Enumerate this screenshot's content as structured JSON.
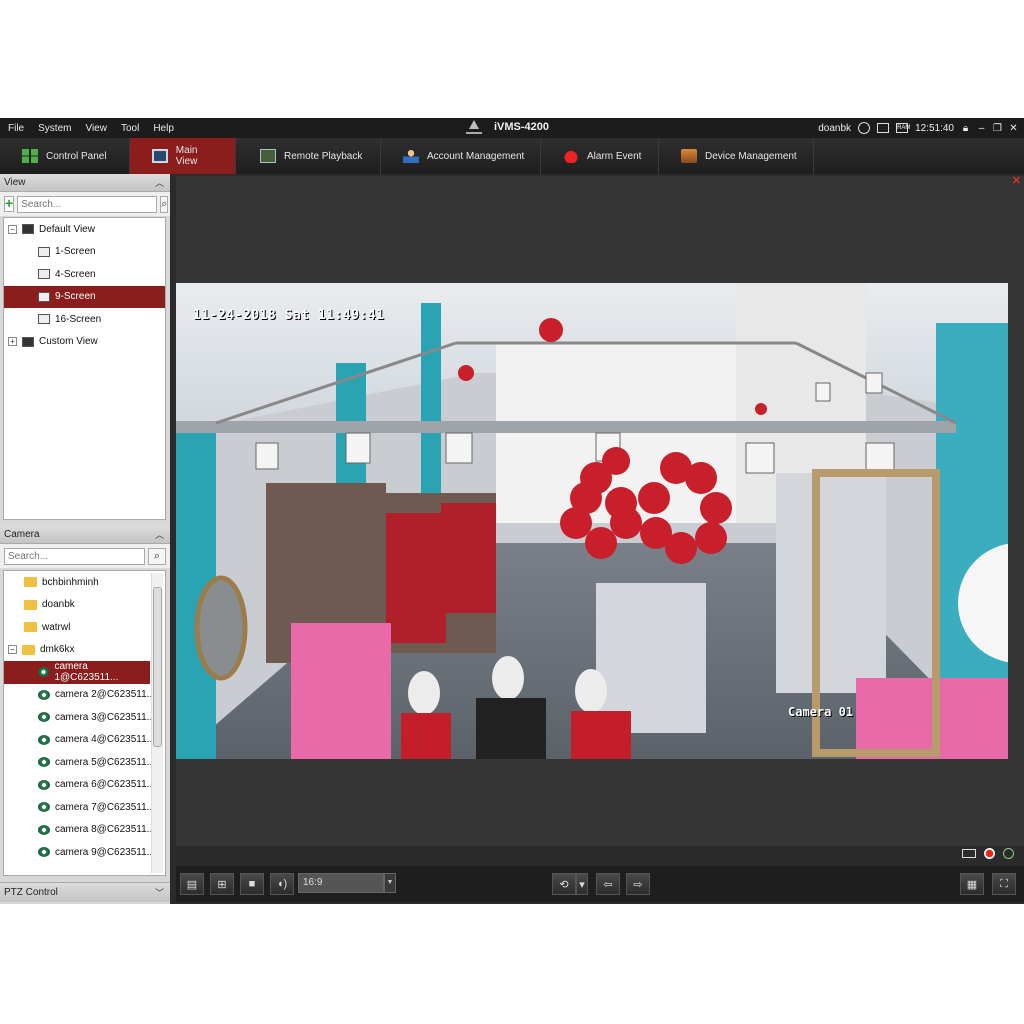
{
  "menu": [
    "File",
    "System",
    "View",
    "Tool",
    "Help"
  ],
  "app_title": "iVMS-4200",
  "status": {
    "user": "doanbk",
    "ram_label": "RAM",
    "time": "12:51:40"
  },
  "tabs": [
    {
      "label": "Control Panel",
      "icon": "control-panel-icon"
    },
    {
      "label": "Main View",
      "icon": "main-view-icon"
    },
    {
      "label": "Remote Playback",
      "icon": "remote-playback-icon"
    },
    {
      "label": "Account Management",
      "icon": "account-management-icon"
    },
    {
      "label": "Alarm Event",
      "icon": "alarm-event-icon"
    },
    {
      "label": "Device Management",
      "icon": "device-management-icon"
    }
  ],
  "view_panel": {
    "title": "View",
    "search_placeholder": "Search...",
    "tree": [
      {
        "label": "Default View",
        "level": 0,
        "expander": "−"
      },
      {
        "label": "1-Screen",
        "level": 1
      },
      {
        "label": "4-Screen",
        "level": 1
      },
      {
        "label": "9-Screen",
        "level": 1,
        "selected": true
      },
      {
        "label": "16-Screen",
        "level": 1
      },
      {
        "label": "Custom View",
        "level": 0,
        "expander": "+"
      }
    ]
  },
  "camera_panel": {
    "title": "Camera",
    "search_placeholder": "Search...",
    "groups": [
      "bchbinhminh",
      "doanbk",
      "watrwl",
      "dmk6kx"
    ],
    "cameras": [
      "camera 1@C623511...",
      "camera 2@C623511...",
      "camera 3@C623511...",
      "camera 4@C623511...",
      "camera 5@C623511...",
      "camera 6@C623511...",
      "camera 7@C623511...",
      "camera 8@C623511...",
      "camera 9@C623511..."
    ]
  },
  "ptz_label": "PTZ Control",
  "video": {
    "osd_time": "11-24-2018 Sat 11:49:41",
    "osd_camera": "Camera 01"
  },
  "toolbar": {
    "aspect_ratio": "16:9"
  },
  "colors": {
    "accent": "#8c1d1d",
    "background": "#2b2b2b",
    "panel": "#d8d8d8"
  }
}
